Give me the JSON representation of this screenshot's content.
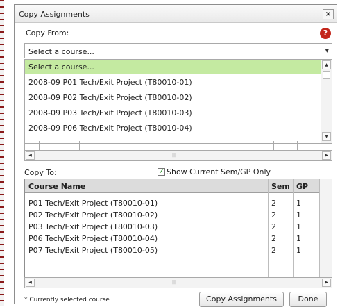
{
  "dialog": {
    "title": "Copy Assignments",
    "close_label": "×",
    "help_label": "?"
  },
  "copy_from": {
    "label": "Copy From:",
    "selected_value": "Select a course...",
    "options": [
      "Select a course...",
      "2008-09 P01 Tech/Exit Project (T80010-01)",
      "2008-09 P02 Tech/Exit Project (T80010-02)",
      "2008-09 P03 Tech/Exit Project (T80010-03)",
      "2008-09 P06 Tech/Exit Project (T80010-04)"
    ],
    "highlight_color": "#c4eaa1"
  },
  "copy_to": {
    "label": "Copy To:",
    "show_current_label": "Show Current Sem/GP Only",
    "show_current_checked": true,
    "columns": [
      "Course Name",
      "Sem",
      "GP"
    ],
    "rows": [
      {
        "course": "P01 Tech/Exit Project (T80010-01)",
        "sem": "2",
        "gp": "1"
      },
      {
        "course": "P02 Tech/Exit Project (T80010-02)",
        "sem": "2",
        "gp": "1"
      },
      {
        "course": "P03 Tech/Exit Project (T80010-03)",
        "sem": "2",
        "gp": "1"
      },
      {
        "course": "P06 Tech/Exit Project (T80010-04)",
        "sem": "2",
        "gp": "1"
      },
      {
        "course": "P07 Tech/Exit Project (T80010-05)",
        "sem": "2",
        "gp": "1"
      }
    ]
  },
  "footer": {
    "note": "* Currently selected course",
    "copy_button": "Copy Assignments",
    "done_button": "Done"
  },
  "icons": {
    "close": "close-icon",
    "help": "help-icon",
    "checkmark": "checkmark-icon",
    "dropdown": "chevron-down-icon"
  }
}
